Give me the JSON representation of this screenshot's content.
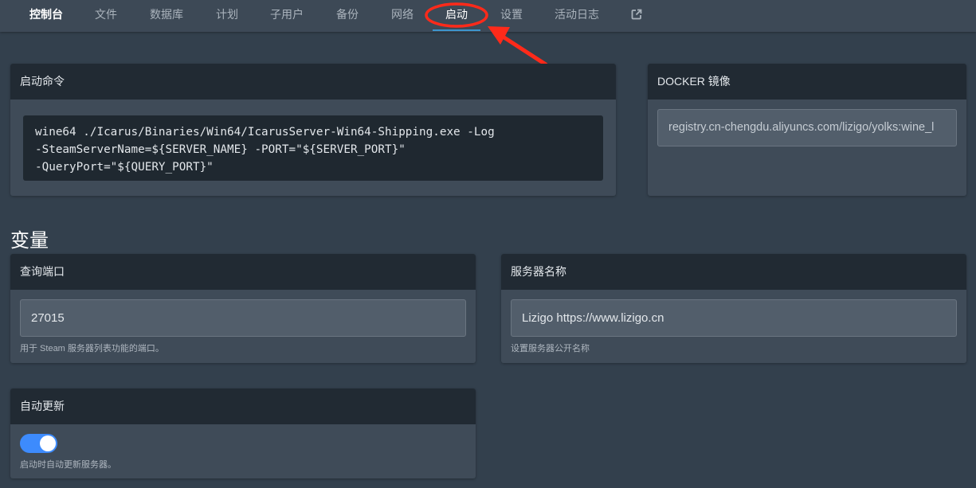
{
  "nav": {
    "tabs": [
      {
        "label": "控制台"
      },
      {
        "label": "文件"
      },
      {
        "label": "数据库"
      },
      {
        "label": "计划"
      },
      {
        "label": "子用户"
      },
      {
        "label": "备份"
      },
      {
        "label": "网络"
      },
      {
        "label": "启动"
      },
      {
        "label": "设置"
      },
      {
        "label": "活动日志"
      }
    ],
    "active_tab": "启动",
    "external_link_icon": "external-link-icon"
  },
  "annotation": {
    "color": "#ff2a1a"
  },
  "startup": {
    "title": "启动命令",
    "command_lines": [
      "wine64 ./Icarus/Binaries/Win64/IcarusServer-Win64-Shipping.exe -Log",
      "-SteamServerName=${SERVER_NAME} -PORT=\"${SERVER_PORT}\"",
      "-QueryPort=\"${QUERY_PORT}\""
    ]
  },
  "docker": {
    "title": "DOCKER 镜像",
    "value": "registry.cn-chengdu.aliyuncs.com/lizigo/yolks:wine_l"
  },
  "variables": {
    "title": "变量",
    "query_port": {
      "label": "查询端口",
      "value": "27015",
      "help": "用于 Steam 服务器列表功能的端口。"
    },
    "server_name": {
      "label": "服务器名称",
      "value": "Lizigo https://www.lizigo.cn",
      "help": "设置服务器公开名称"
    },
    "auto_update": {
      "label": "自动更新",
      "enabled": true,
      "help": "启动时自动更新服务器。"
    }
  },
  "colors": {
    "accent": "#3e95cd",
    "toggle_on": "#3d8bfd",
    "header_bg": "#212a33"
  }
}
